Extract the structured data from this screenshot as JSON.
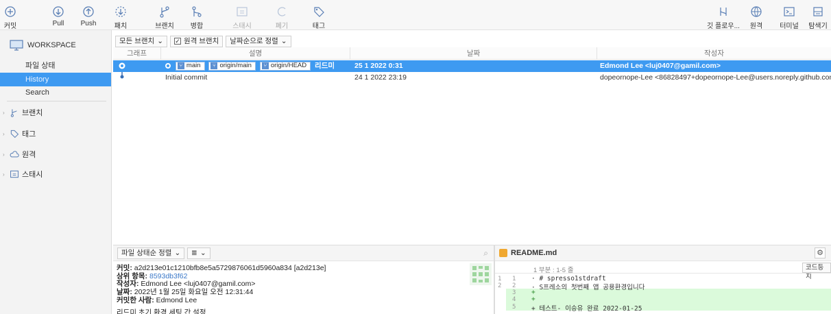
{
  "toolbar": {
    "commit": "커밋",
    "pull": "Pull",
    "push": "Push",
    "fetch": "패치",
    "branch": "브랜치",
    "merge": "병합",
    "stash": "스태시",
    "discard": "폐기",
    "tag": "태그",
    "gitflow": "깃 플로우...",
    "remote": "원격",
    "terminal": "터미널",
    "explorer": "탐색기"
  },
  "sidebar": {
    "workspace": "WORKSPACE",
    "items": [
      "파일 상태",
      "History",
      "Search"
    ],
    "groups": [
      "브랜치",
      "태그",
      "원격",
      "스태시"
    ]
  },
  "filters": {
    "all_branches": "모든 브랜치",
    "remote_branches": "원격 브랜치",
    "sort_by_date": "날짜순으로 정렬"
  },
  "columns": [
    "그래프",
    "설명",
    "날짜",
    "작성자"
  ],
  "commits": [
    {
      "tags": [
        "main",
        "origin/main",
        "origin/HEAD"
      ],
      "description": "리드미",
      "date": "25 1 2022 0:31",
      "author": "Edmond Lee <luj0407@gamil.com>",
      "selected": true
    },
    {
      "tags": [],
      "description": "Initial commit",
      "date": "24 1 2022 23:19",
      "author": "dopeornope-Lee <86828497+dopeornope-Lee@users.noreply.github.com",
      "selected": false
    }
  ],
  "bottom_left": {
    "sort": "파일 상태순 정렬",
    "commit_label": "커밋:",
    "commit_value": "a2d213e01c1210bfb8e5a5729876061d5960a834 [a2d213e]",
    "parent_label": "상위 항목:",
    "parent_value": "8593db3f62",
    "author_label": "작성자:",
    "author_value": "Edmond Lee <luj0407@gamil.com>",
    "date_label": "날짜:",
    "date_value": "2022년 1월 25일 화요일 오전 12:31:44",
    "committer_label": "커밋한 사람:",
    "committer_value": "Edmond Lee",
    "message": "리드미 초기 환경 세팅 간 설정"
  },
  "diff": {
    "file": "README.md",
    "hunk": "1 부분 : 1-5 줄",
    "mode_button": "코드등치",
    "lines": [
      {
        "old": "1",
        "new": "1",
        "text": "· # spresso1stdraft",
        "added": false
      },
      {
        "old": "2",
        "new": "2",
        "text": "· S프레소의 첫번째 앱 공용환경입니다",
        "added": false
      },
      {
        "old": "",
        "new": "3",
        "text": "+",
        "added": true
      },
      {
        "old": "",
        "new": "4",
        "text": "+",
        "added": true
      },
      {
        "old": "",
        "new": "5",
        "text": "+ 테스트- 이승유 완료 2022-01-25",
        "added": true
      }
    ]
  },
  "colors": {
    "accent": "#3e9af1",
    "icon": "#5a7fb5",
    "added_bg": "#dbfadb"
  }
}
